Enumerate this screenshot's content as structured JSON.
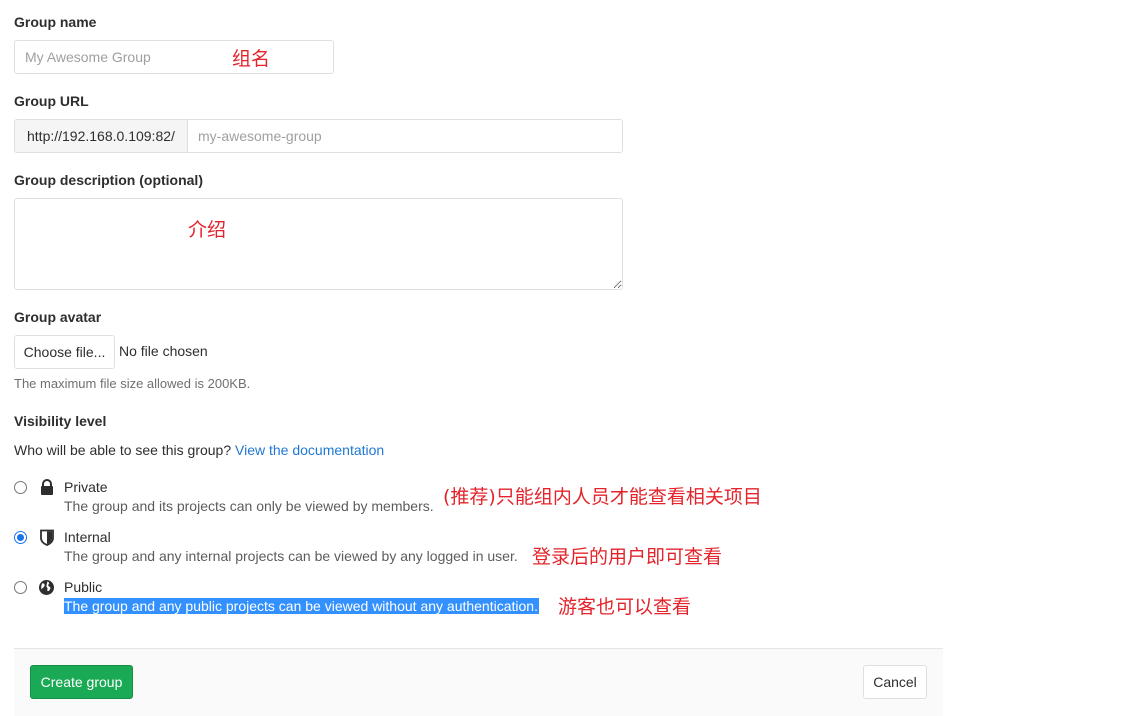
{
  "group_name": {
    "label": "Group name",
    "placeholder": "My Awesome Group",
    "annotation": "组名"
  },
  "group_url": {
    "label": "Group URL",
    "prefix": "http://192.168.0.109:82/",
    "placeholder": "my-awesome-group"
  },
  "group_description": {
    "label": "Group description (optional)",
    "annotation": "介绍"
  },
  "group_avatar": {
    "label": "Group avatar",
    "choose_button": "Choose file...",
    "file_status": "No file chosen",
    "help": "The maximum file size allowed is 200KB."
  },
  "visibility": {
    "label": "Visibility level",
    "question": "Who will be able to see this group?",
    "doc_link": "View the documentation",
    "options": [
      {
        "title": "Private",
        "icon": "lock-icon",
        "description": "The group and its projects can only be viewed by members.",
        "checked": false,
        "annotation": "(推荐)只能组内人员才能查看相关项目"
      },
      {
        "title": "Internal",
        "icon": "shield-icon",
        "description": "The group and any internal projects can be viewed by any logged in user.",
        "checked": true,
        "annotation": "登录后的用户即可查看"
      },
      {
        "title": "Public",
        "icon": "globe-icon",
        "description": "The group and any public projects can be viewed without any authentication.",
        "checked": false,
        "annotation": "游客也可以查看"
      }
    ]
  },
  "actions": {
    "create_label": "Create group",
    "cancel_label": "Cancel"
  },
  "colors": {
    "primary_button": "#1aaa55",
    "link": "#1f78d1",
    "annotation": "#e3242b",
    "selection_highlight": "#3390ff"
  }
}
